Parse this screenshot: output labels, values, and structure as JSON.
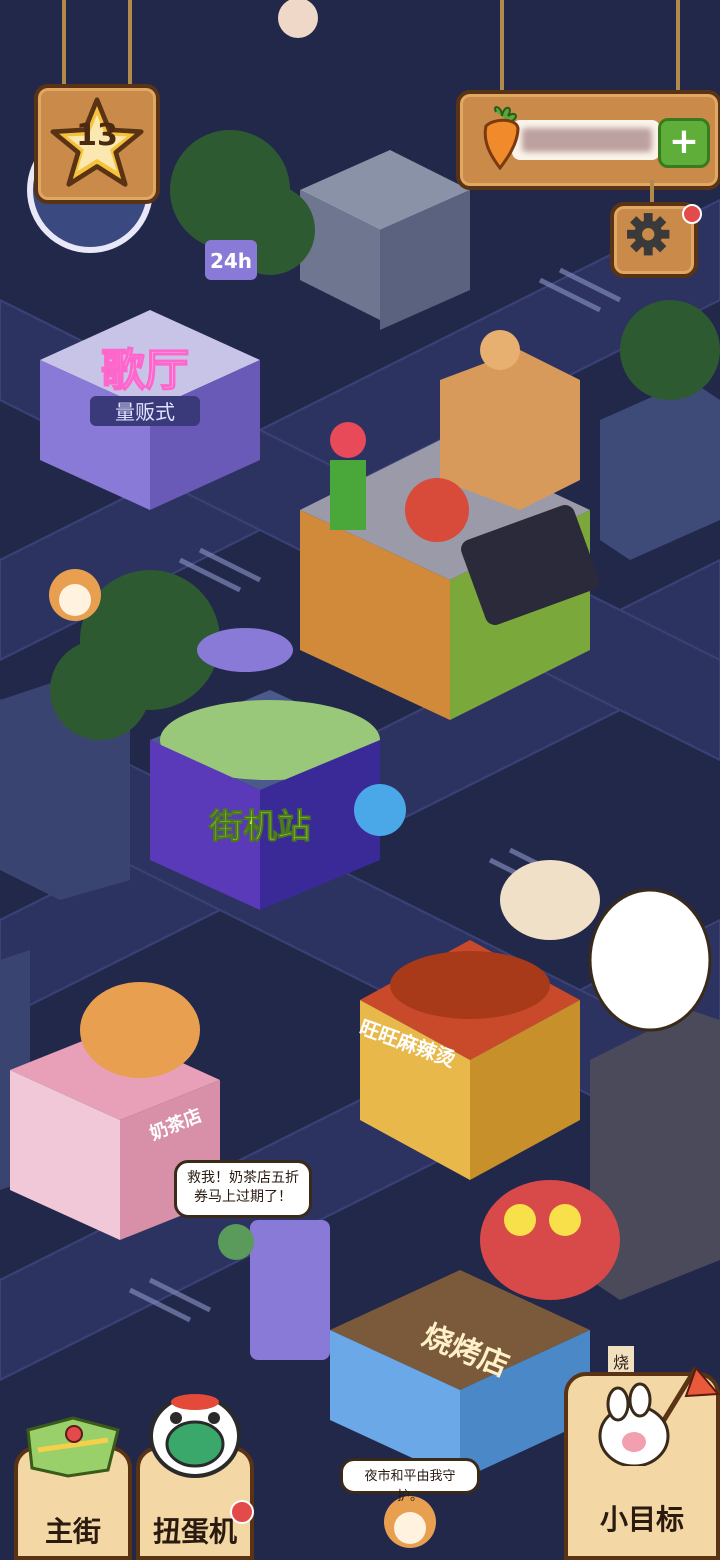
{
  "hud": {
    "level": "13",
    "currency": {
      "icon": "carrot-icon",
      "value": "",
      "add_button": "+"
    },
    "settings": {
      "icon": "gear-icon",
      "has_notification": true
    }
  },
  "city": {
    "signs": {
      "ktv_title": "歌厅",
      "ktv_subtitle": "量贩式",
      "ktv_24h": "24h",
      "arcade_title": "街机站",
      "hotpot_title": "旺旺麻辣烫",
      "milktea_title": "奶茶店",
      "bbq_title": "烧烤店",
      "bbq_side": "烧"
    }
  },
  "bubbles": {
    "milktea": "救我！奶茶店五折券马上过期了！",
    "night_market": "夜市和平由我守护。"
  },
  "bottom_nav": {
    "main_street": "主街",
    "gacha": "扭蛋机",
    "goals": "小目标"
  },
  "colors": {
    "night_bg": "#22284a",
    "wood": "#c98a4a",
    "wood_dark": "#5a3315",
    "card": "#f3d7a5",
    "notify_red": "#e34a4a",
    "add_green": "#5fae3a"
  }
}
